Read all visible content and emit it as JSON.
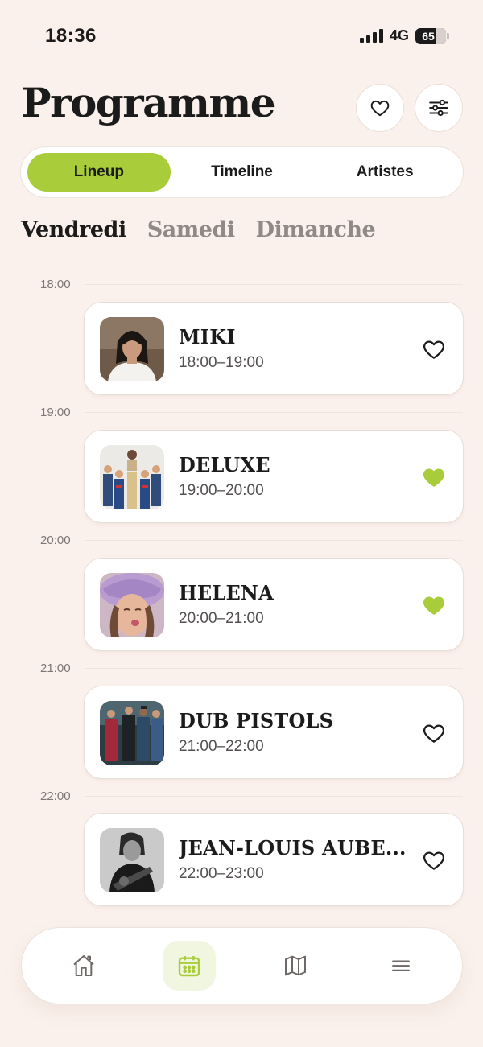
{
  "status_bar": {
    "time": "18:36",
    "network": "4G",
    "battery": "65",
    "battery_level": 0.65
  },
  "header": {
    "title": "Programme",
    "favorites_icon": "heart-outline-icon",
    "filter_icon": "sliders-icon"
  },
  "view_tabs": [
    {
      "label": "Lineup",
      "active": true
    },
    {
      "label": "Timeline",
      "active": false
    },
    {
      "label": "Artistes",
      "active": false
    }
  ],
  "day_tabs": [
    {
      "label": "Vendredi",
      "active": true
    },
    {
      "label": "Samedi",
      "active": false
    },
    {
      "label": "Dimanche",
      "active": false
    }
  ],
  "hours": [
    "18:00",
    "19:00",
    "20:00",
    "21:00",
    "22:00"
  ],
  "slots": [
    {
      "artist": "MIKI",
      "time": "18:00–19:00",
      "favorite": false,
      "photo_icon": "artist-photo-miki"
    },
    {
      "artist": "DELUXE",
      "time": "19:00–20:00",
      "favorite": true,
      "photo_icon": "artist-photo-deluxe"
    },
    {
      "artist": "HELENA",
      "time": "20:00–21:00",
      "favorite": true,
      "photo_icon": "artist-photo-helena"
    },
    {
      "artist": "DUB PISTOLS",
      "time": "21:00–22:00",
      "favorite": false,
      "photo_icon": "artist-photo-dub-pistols"
    },
    {
      "artist": "JEAN-LOUIS AUBE...",
      "time": "22:00–23:00",
      "favorite": false,
      "photo_icon": "artist-photo-jean-louis-aubert"
    }
  ],
  "bottom_nav": [
    {
      "icon": "home-icon",
      "active": false
    },
    {
      "icon": "calendar-icon",
      "active": true
    },
    {
      "icon": "map-icon",
      "active": false
    },
    {
      "icon": "menu-icon",
      "active": false
    }
  ],
  "colors": {
    "background": "#fbf1ec",
    "accent": "#a9cd3a",
    "text": "#1b1b1b",
    "muted": "#8f8987"
  }
}
